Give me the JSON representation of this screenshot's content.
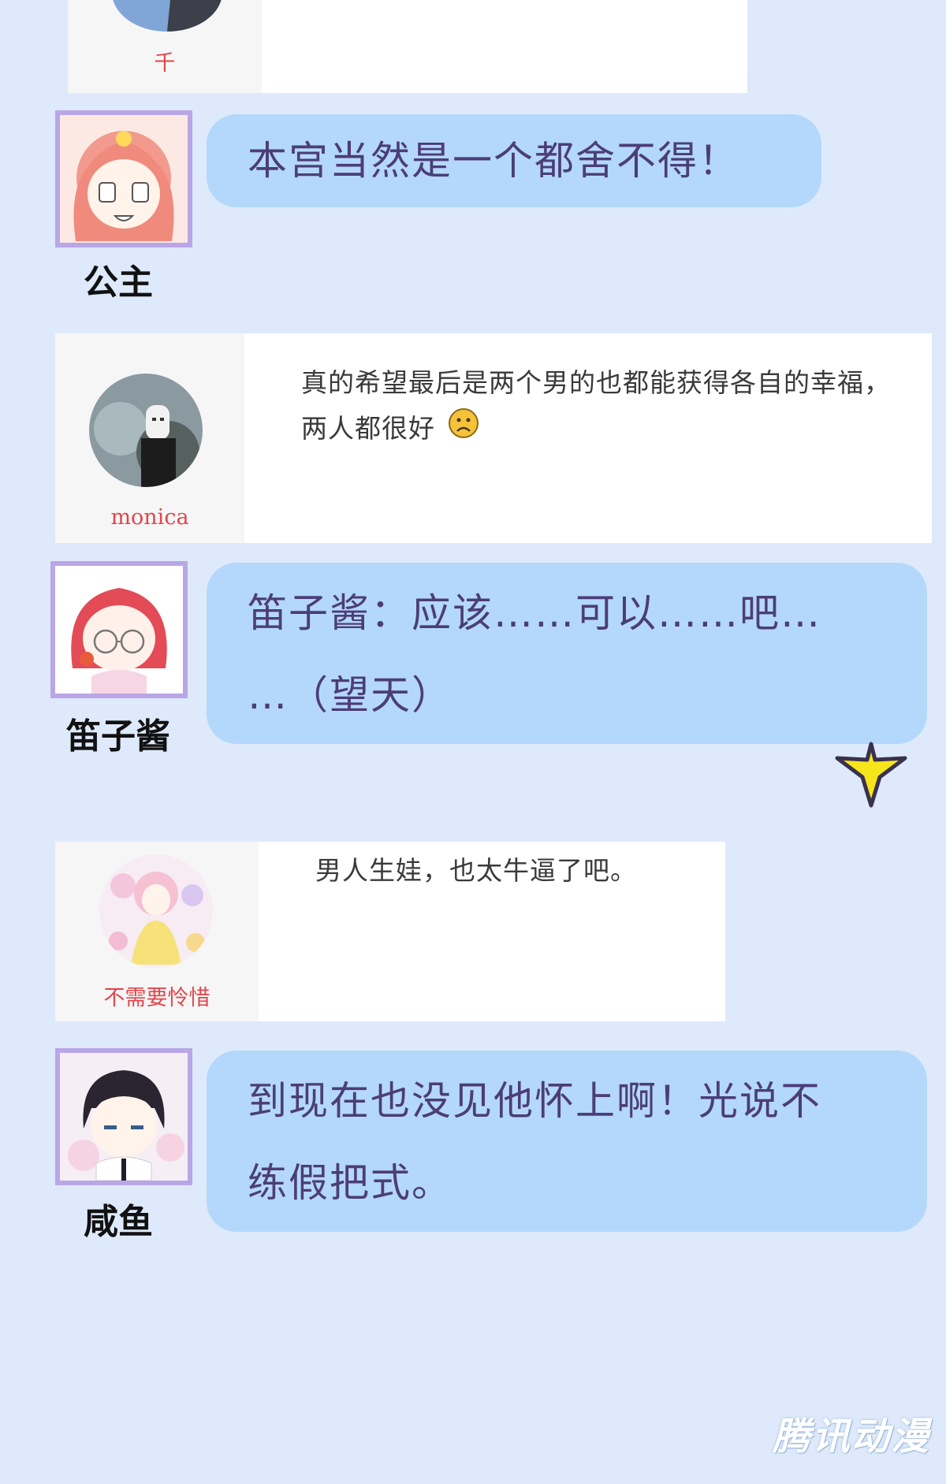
{
  "comments": [
    {
      "user": "千",
      "text": ""
    },
    {
      "user": "monica",
      "text_lines": [
        "真的希望最后是两个男的也都能获得各自的幸福，",
        "两人都很好"
      ],
      "emoji": "frowning-face-emoji"
    },
    {
      "user": "不需要怜惜",
      "text": "男人生娃，也太牛逼了吧。"
    }
  ],
  "replies": [
    {
      "speaker": "公主",
      "lines": [
        "本宫当然是一个都舍不得！"
      ]
    },
    {
      "speaker": "笛子酱",
      "lines": [
        "笛子酱：应该……可以……吧…",
        "…（望天）"
      ]
    },
    {
      "speaker": "咸鱼",
      "lines": [
        "到现在也没见他怀上啊！光说不",
        "练假把式。"
      ]
    }
  ],
  "watermark": "腾讯动漫",
  "colors": {
    "background": "#deeafb",
    "bubble": "#b3d8fb",
    "bubble_text": "#4c3d78",
    "avatar_frame": "#b9a6e6",
    "comment_user": "#e0464b",
    "star": "#f7e51c"
  }
}
